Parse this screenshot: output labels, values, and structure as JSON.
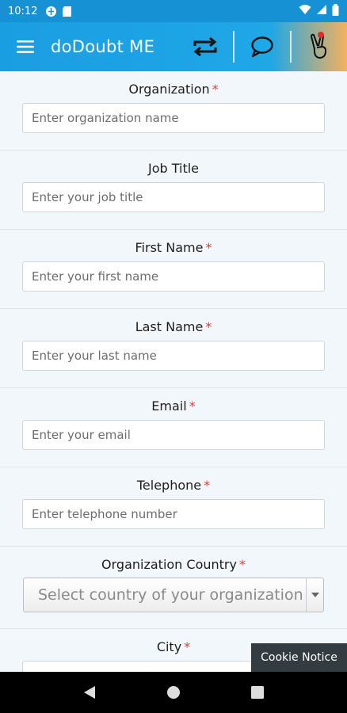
{
  "status_bar": {
    "time": "10:12"
  },
  "app_bar": {
    "title": "doDoubt ME"
  },
  "form": {
    "required_mark": "*",
    "fields": [
      {
        "label": "Organization",
        "required": true,
        "placeholder": "Enter organization name"
      },
      {
        "label": "Job Title",
        "required": false,
        "placeholder": "Enter your job title"
      },
      {
        "label": "First Name",
        "required": true,
        "placeholder": "Enter your first name"
      },
      {
        "label": "Last Name",
        "required": true,
        "placeholder": "Enter your last name"
      },
      {
        "label": "Email",
        "required": true,
        "placeholder": "Enter your email"
      },
      {
        "label": "Telephone",
        "required": true,
        "placeholder": "Enter telephone number"
      }
    ],
    "country": {
      "label": "Organization Country",
      "required": true,
      "selected": "Select country of your organization"
    },
    "city": {
      "label": "City",
      "required": true
    }
  },
  "cookie_notice": "Cookie Notice",
  "colors": {
    "brand": "#1a9ee2",
    "accent": "#f5b15c",
    "required": "#e53935"
  }
}
